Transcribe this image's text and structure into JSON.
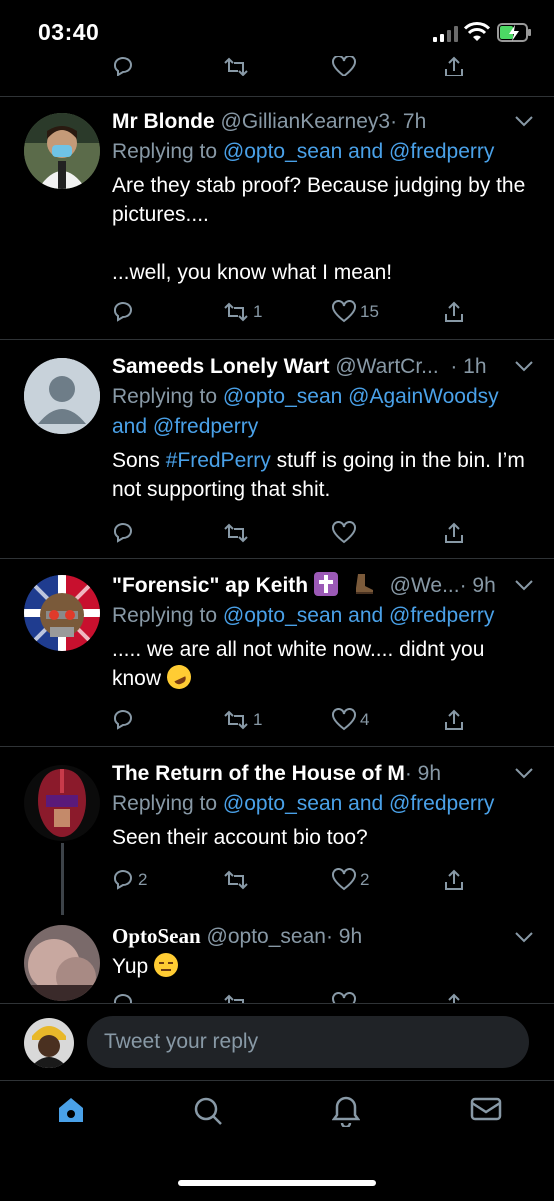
{
  "status": {
    "time": "03:40"
  },
  "tweets": [
    {
      "name": "Mr Blonde",
      "handle": "@GillianKearney3",
      "time": "· 7h",
      "replying_prefix": "Replying to ",
      "mentions": "@opto_sean and @fredperry",
      "text1": "Are they stab proof? Because judging by the pictures....",
      "text2": "...well, you know what I mean!",
      "retweets": "1",
      "likes": "15"
    },
    {
      "name": "Sameeds Lonely Wart",
      "handle": "@WartCr...",
      "time": "· 1h",
      "replying_prefix": "Replying to ",
      "mentions_line1": "@opto_sean @AgainWoodsy",
      "mentions_line2": "and @fredperry",
      "text_pre": "Sons ",
      "hashtag": "#FredPerry",
      "text_post": " stuff is going in the bin. I’m not supporting that shit."
    },
    {
      "name": "\"Forensic\" ap Keith",
      "handle": "@We...",
      "time": "· 9h",
      "replying_prefix": "Replying to ",
      "mentions": "@opto_sean and @fredperry",
      "text": "..... we are all not white now.... didnt you know",
      "retweets": "1",
      "likes": "4"
    },
    {
      "name": "The Return of the House of M",
      "time": "· 9h",
      "replying_prefix": "Replying to ",
      "mentions": "@opto_sean and @fredperry",
      "text": "Seen their account bio too?",
      "replies": "2",
      "likes": "2"
    },
    {
      "name": "OptoSean",
      "handle": "@opto_sean",
      "time": "· 9h",
      "text": "Yup"
    }
  ],
  "reply_bar": {
    "placeholder": "Tweet your reply"
  },
  "colors": {
    "accent": "#4aa1e8",
    "muted": "#8899a6",
    "background": "#000000",
    "divider": "#2f3336"
  },
  "tabs": [
    "home-icon",
    "search-icon",
    "notifications-icon",
    "messages-icon"
  ]
}
